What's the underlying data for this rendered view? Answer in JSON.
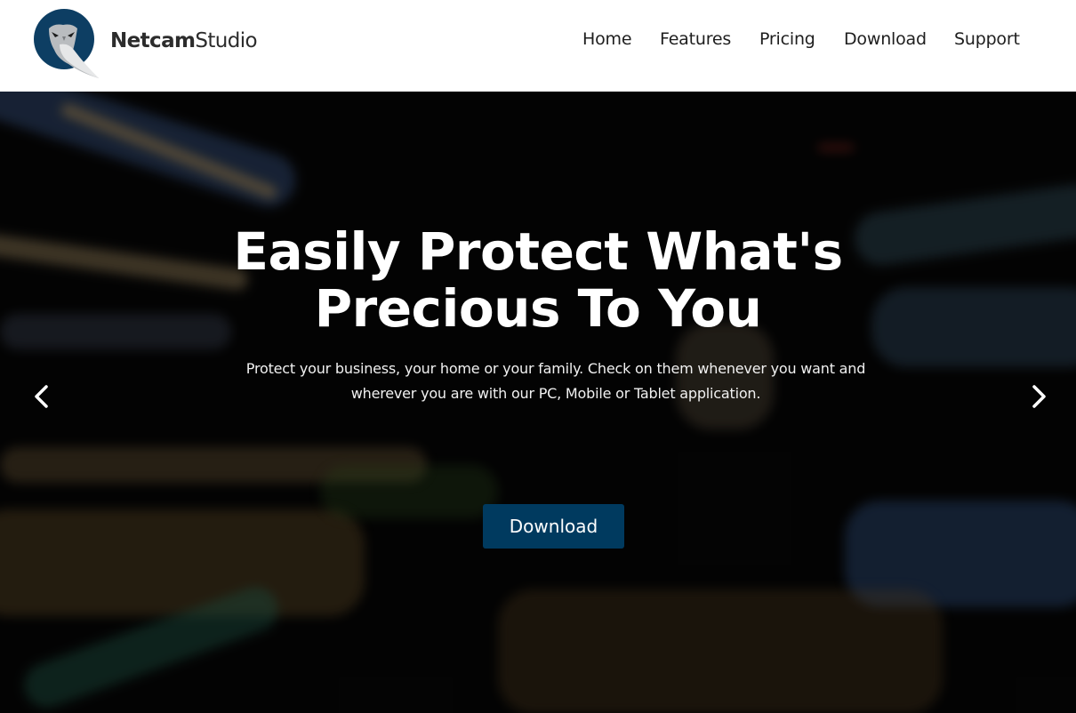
{
  "header": {
    "brand": {
      "bold": "Netcam",
      "light": "Studio"
    },
    "logo_icon": "owl-logo-icon",
    "nav": [
      {
        "label": "Home"
      },
      {
        "label": "Features"
      },
      {
        "label": "Pricing"
      },
      {
        "label": "Download"
      },
      {
        "label": "Support"
      }
    ]
  },
  "hero": {
    "title_line1": "Easily Protect What's",
    "title_line2": "Precious To You",
    "subtitle_line1": "Protect your business, your home or your family. Check on them whenever you want and",
    "subtitle_line2": "wherever you are with our PC, Mobile or Tablet application.",
    "cta_label": "Download",
    "prev_icon": "chevron-left-icon",
    "next_icon": "chevron-right-icon"
  },
  "colors": {
    "brand_blue": "#003a5f",
    "logo_circle": "#0d3e63",
    "nav_text": "#1e1e1e"
  }
}
